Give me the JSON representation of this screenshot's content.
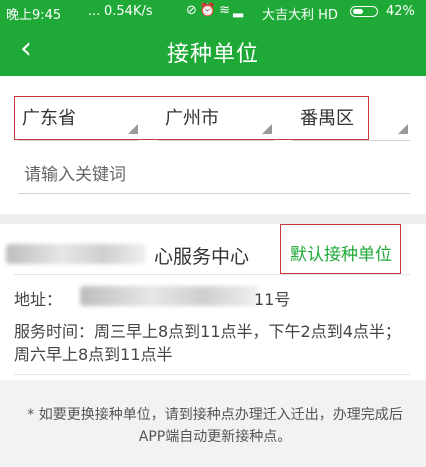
{
  "status_bar": {
    "time": "晚上9:45",
    "dots": "...",
    "speed": "0.54K/s",
    "icons_text": "⊘⏰≋▂",
    "carrier": "大吉大利 HD",
    "battery": "42%"
  },
  "header": {
    "back_icon": "‹",
    "title": "接种单位"
  },
  "region": {
    "province": "广东省",
    "city": "广州市",
    "district": "番禺区"
  },
  "search": {
    "placeholder": "请输入关键词",
    "value": ""
  },
  "unit": {
    "name_visible": "心服务中心",
    "default_label": "默认接种单位",
    "address_label": "地址：",
    "address_tail": "11号",
    "service_time": "服务时间：周三早上8点到11点半，下午2点到4点半；周六早上8点到11点半"
  },
  "notice": {
    "text": "* 如要更换接种单位，请到接种点办理迁入迁出，办理完成后APP端自动更新接种点。"
  },
  "colors": {
    "brand_green": "#1faa38",
    "highlight_red": "#c9393a"
  }
}
